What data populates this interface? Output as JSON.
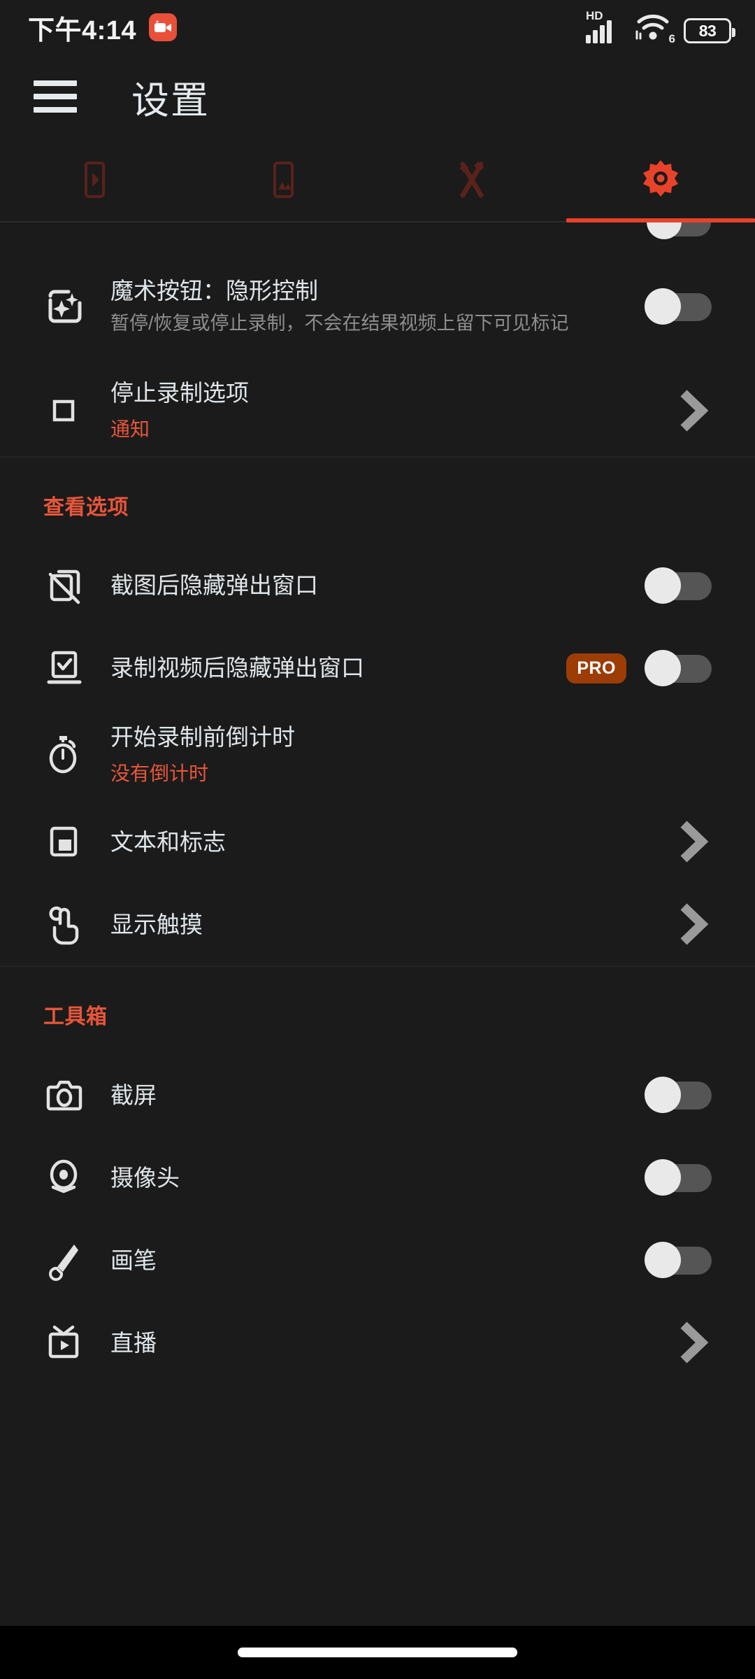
{
  "status_bar": {
    "time": "下午4:14",
    "app_icon": "video-recorder-icon",
    "network_label": "HD",
    "signal_icon": "cellular-signal-icon",
    "wifi_icon": "wifi-icon",
    "wifi_generation": "6",
    "battery_level": "83",
    "battery_icon": "battery-icon"
  },
  "header": {
    "menu_icon": "hamburger-menu-icon",
    "title": "设置"
  },
  "tabs": [
    {
      "name": "video",
      "icon": "video-play-icon",
      "active": false
    },
    {
      "name": "images",
      "icon": "image-gallery-icon",
      "active": false
    },
    {
      "name": "tools",
      "icon": "tools-wrench-hammer-icon",
      "active": false
    },
    {
      "name": "settings",
      "icon": "gear-icon",
      "active": true
    }
  ],
  "accent_color": "#e8563a",
  "tab_active_color": "#e8432a",
  "pro_badge_color": "#9c3d06",
  "sections": [
    {
      "header": null,
      "rows": [
        {
          "icon": "magic-sparkle-icon",
          "title": "魔术按钮：隐形控制",
          "subtitle": "暂停/恢复或停止录制，不会在结果视频上留下可见标记",
          "subtitle_accent": false,
          "control": "toggle",
          "toggle_on": false,
          "pro": false
        },
        {
          "icon": "stop-square-icon",
          "title": "停止录制选项",
          "subtitle": "通知",
          "subtitle_accent": true,
          "control": "chevron",
          "toggle_on": false,
          "pro": false
        }
      ]
    },
    {
      "header": "查看选项",
      "rows": [
        {
          "icon": "hide-popup-screenshot-icon",
          "title": "截图后隐藏弹出窗口",
          "subtitle": null,
          "subtitle_accent": false,
          "control": "toggle",
          "toggle_on": false,
          "pro": false
        },
        {
          "icon": "hide-popup-video-icon",
          "title": "录制视频后隐藏弹出窗口",
          "subtitle": null,
          "subtitle_accent": false,
          "control": "toggle",
          "toggle_on": false,
          "pro": true,
          "pro_label": "PRO"
        },
        {
          "icon": "stopwatch-icon",
          "title": "开始录制前倒计时",
          "subtitle": "没有倒计时",
          "subtitle_accent": true,
          "control": "none",
          "toggle_on": false,
          "pro": false
        },
        {
          "icon": "text-logo-icon",
          "title": "文本和标志",
          "subtitle": null,
          "subtitle_accent": false,
          "control": "chevron",
          "toggle_on": false,
          "pro": false
        },
        {
          "icon": "show-touches-icon",
          "title": "显示触摸",
          "subtitle": null,
          "subtitle_accent": false,
          "control": "chevron",
          "toggle_on": false,
          "pro": false
        }
      ]
    },
    {
      "header": "工具箱",
      "rows": [
        {
          "icon": "camera-icon",
          "title": "截屏",
          "subtitle": null,
          "subtitle_accent": false,
          "control": "toggle",
          "toggle_on": false,
          "pro": false
        },
        {
          "icon": "webcam-icon",
          "title": "摄像头",
          "subtitle": null,
          "subtitle_accent": false,
          "control": "toggle",
          "toggle_on": false,
          "pro": false
        },
        {
          "icon": "paintbrush-icon",
          "title": "画笔",
          "subtitle": null,
          "subtitle_accent": false,
          "control": "toggle",
          "toggle_on": false,
          "pro": false
        },
        {
          "icon": "live-stream-icon",
          "title": "直播",
          "subtitle": null,
          "subtitle_accent": false,
          "control": "chevron",
          "toggle_on": false,
          "pro": false
        }
      ]
    }
  ],
  "nav_bar": {
    "home_indicator": "home-pill-indicator"
  }
}
